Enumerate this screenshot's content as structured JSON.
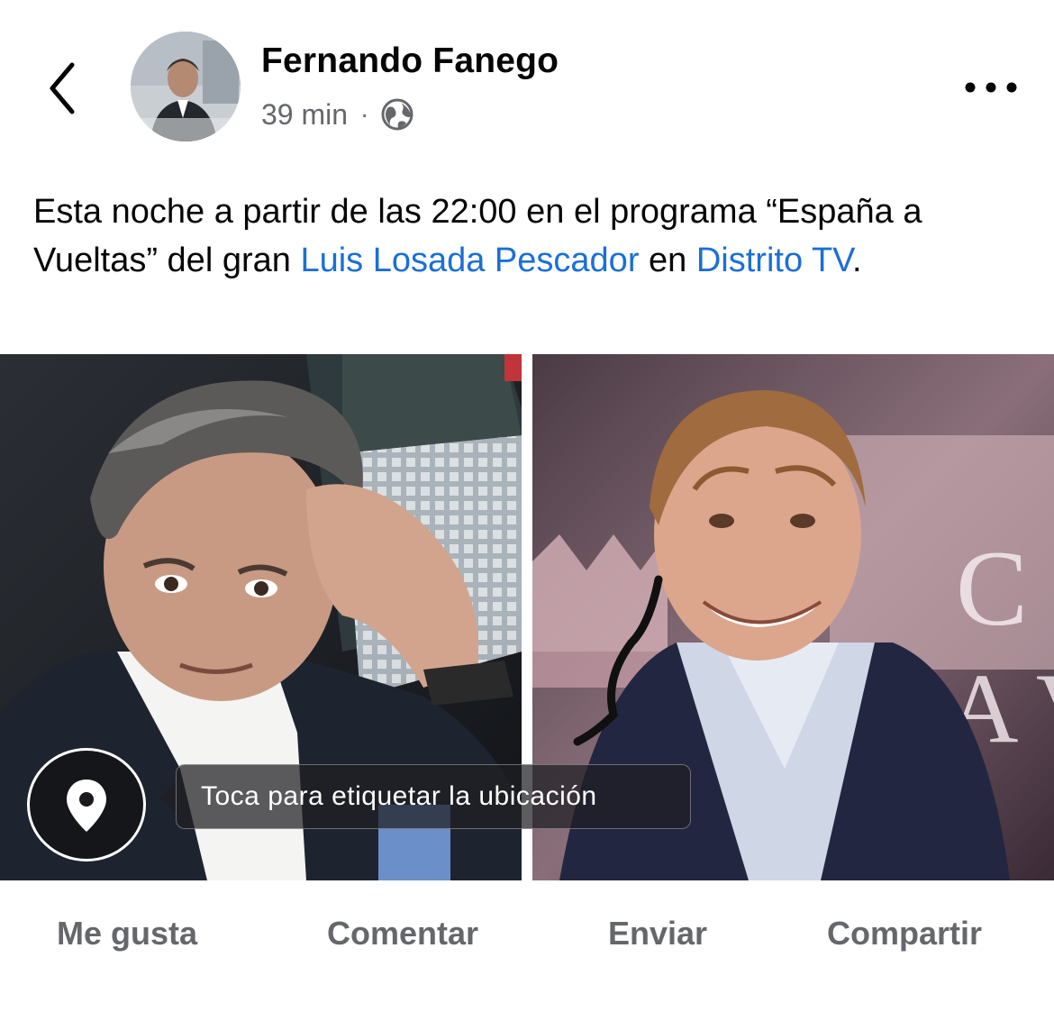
{
  "header": {
    "author_name": "Fernando Fanego",
    "timestamp": "39 min",
    "separator": "·",
    "privacy_icon": "globe-icon",
    "back_icon": "chevron-left-icon",
    "more_icon": "more-horizontal-icon"
  },
  "post": {
    "text_part1": "Esta noche a partir de las 22:00 en el programa “España a Vueltas” del gran ",
    "mention1": "Luis Losada Pescador",
    "text_part2": " en ",
    "mention2": "Distrito TV",
    "text_part3": "."
  },
  "photos": [
    {
      "name": "photo-left"
    },
    {
      "name": "photo-right"
    }
  ],
  "location": {
    "icon": "location-pin-icon",
    "tooltip": "Toca para etiquetar la ubicación"
  },
  "actions": {
    "like": "Me gusta",
    "comment": "Comentar",
    "send": "Enviar",
    "share": "Compartir"
  },
  "colors": {
    "link": "#1b6fd6",
    "secondary_text": "#65676b",
    "primary_text": "#050505"
  }
}
